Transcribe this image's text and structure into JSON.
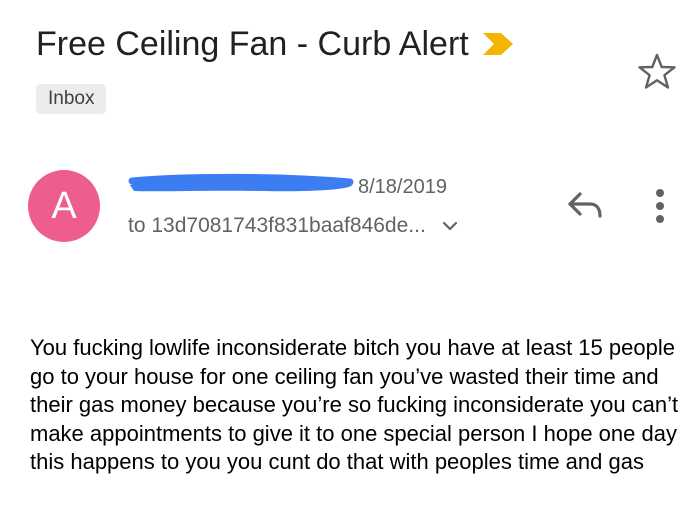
{
  "email": {
    "subject": "Free Ceiling Fan - Curb Alert",
    "label": "Inbox",
    "sender": {
      "avatar_letter": "A",
      "avatar_color": "#ee5e8d",
      "name_redacted": true,
      "redaction_color": "#3d7df2"
    },
    "date": "8/18/2019",
    "recipients": "to 13d7081743f831baaf846de...",
    "body": "You fucking lowlife inconsiderate bitch you have at least 15 people go to your house for one ceiling fan you’ve wasted their time and their gas money because you’re so fucking inconsiderate you can’t make appointments to give it to one special person I hope one day this happens to you you cunt do that with peoples time and gas"
  },
  "icons": {
    "importance": "importance-marker-icon",
    "star": "star-outline-icon",
    "expand": "chevron-down-icon",
    "reply": "reply-icon",
    "more": "more-vert-icon"
  },
  "colors": {
    "importance_marker": "#f4b400",
    "icon_gray": "#5f6368",
    "chip_bg": "#ececec"
  }
}
